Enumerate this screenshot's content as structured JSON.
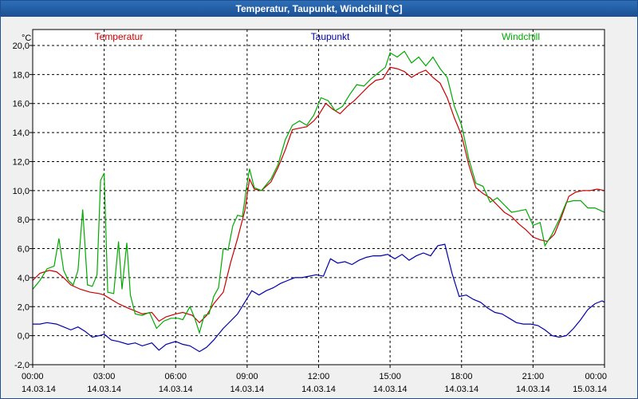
{
  "window": {
    "title": "Temperatur, Taupunkt, Windchill [°C]"
  },
  "chart_data": {
    "type": "line",
    "title": "Temperatur, Taupunkt, Windchill [°C]",
    "ylabel": "°C",
    "ylim": [
      -2,
      20
    ],
    "xlim": [
      0,
      24
    ],
    "grid": true,
    "legend": "top",
    "yticks": [
      {
        "v": 20,
        "label": "20,0"
      },
      {
        "v": 18,
        "label": "18,0"
      },
      {
        "v": 16,
        "label": "16,0"
      },
      {
        "v": 14,
        "label": "14,0"
      },
      {
        "v": 12,
        "label": "12,0"
      },
      {
        "v": 10,
        "label": "10,0"
      },
      {
        "v": 8,
        "label": "8,0"
      },
      {
        "v": 6,
        "label": "6,0"
      },
      {
        "v": 4,
        "label": "4,0"
      },
      {
        "v": 2,
        "label": "2,0"
      },
      {
        "v": 0,
        "label": "0,0"
      },
      {
        "v": -2,
        "label": "-2,0"
      }
    ],
    "xticks": [
      {
        "v": 0,
        "time": "00:00",
        "date": "14.03.14"
      },
      {
        "v": 3,
        "time": "03:00",
        "date": "14.03.14"
      },
      {
        "v": 6,
        "time": "06:00",
        "date": "14.03.14"
      },
      {
        "v": 9,
        "time": "09:00",
        "date": "14.03.14"
      },
      {
        "v": 12,
        "time": "12:00",
        "date": "14.03.14"
      },
      {
        "v": 15,
        "time": "15:00",
        "date": "14.03.14"
      },
      {
        "v": 18,
        "time": "18:00",
        "date": "14.03.14"
      },
      {
        "v": 21,
        "time": "21:00",
        "date": "14.03.14"
      },
      {
        "v": 24,
        "time": "00:00",
        "date": "15.03.14"
      }
    ],
    "series": [
      {
        "name": "Temperatur",
        "color": "#cc0000",
        "points": [
          [
            0,
            3.8
          ],
          [
            0.3,
            4.3
          ],
          [
            0.7,
            4.5
          ],
          [
            1.0,
            4.4
          ],
          [
            1.3,
            4.0
          ],
          [
            1.6,
            3.5
          ],
          [
            2.0,
            3.2
          ],
          [
            2.4,
            3.0
          ],
          [
            2.8,
            2.9
          ],
          [
            3.0,
            2.8
          ],
          [
            3.3,
            2.5
          ],
          [
            3.6,
            2.2
          ],
          [
            4.0,
            1.9
          ],
          [
            4.3,
            1.7
          ],
          [
            4.6,
            1.5
          ],
          [
            5.0,
            1.6
          ],
          [
            5.3,
            1.0
          ],
          [
            5.6,
            1.3
          ],
          [
            6.0,
            1.5
          ],
          [
            6.3,
            1.6
          ],
          [
            6.7,
            1.4
          ],
          [
            7.0,
            0.9
          ],
          [
            7.3,
            1.4
          ],
          [
            7.6,
            2.2
          ],
          [
            8.0,
            3.0
          ],
          [
            8.3,
            5.0
          ],
          [
            8.6,
            6.7
          ],
          [
            8.9,
            8.6
          ],
          [
            9.1,
            10.8
          ],
          [
            9.3,
            10.1
          ],
          [
            9.6,
            10.0
          ],
          [
            10.0,
            10.6
          ],
          [
            10.3,
            11.6
          ],
          [
            10.6,
            12.8
          ],
          [
            10.9,
            14.2
          ],
          [
            11.2,
            14.3
          ],
          [
            11.5,
            14.4
          ],
          [
            11.8,
            14.8
          ],
          [
            12.0,
            15.2
          ],
          [
            12.3,
            16.0
          ],
          [
            12.6,
            15.6
          ],
          [
            12.9,
            15.3
          ],
          [
            13.2,
            15.8
          ],
          [
            13.5,
            16.2
          ],
          [
            13.8,
            16.7
          ],
          [
            14.1,
            17.2
          ],
          [
            14.4,
            17.6
          ],
          [
            14.7,
            17.7
          ],
          [
            15.0,
            18.5
          ],
          [
            15.3,
            18.4
          ],
          [
            15.6,
            18.2
          ],
          [
            15.9,
            17.8
          ],
          [
            16.2,
            18.1
          ],
          [
            16.5,
            18.3
          ],
          [
            16.8,
            17.8
          ],
          [
            17.1,
            17.4
          ],
          [
            17.4,
            16.4
          ],
          [
            17.7,
            15.0
          ],
          [
            18.0,
            13.8
          ],
          [
            18.3,
            11.8
          ],
          [
            18.6,
            10.2
          ],
          [
            18.9,
            9.8
          ],
          [
            19.2,
            9.5
          ],
          [
            19.5,
            9.0
          ],
          [
            19.8,
            8.5
          ],
          [
            20.1,
            8.2
          ],
          [
            20.4,
            7.7
          ],
          [
            20.7,
            7.3
          ],
          [
            21.0,
            6.8
          ],
          [
            21.3,
            6.6
          ],
          [
            21.6,
            6.5
          ],
          [
            21.9,
            7.0
          ],
          [
            22.2,
            8.2
          ],
          [
            22.5,
            9.6
          ],
          [
            22.8,
            9.9
          ],
          [
            23.1,
            10.0
          ],
          [
            23.4,
            10.0
          ],
          [
            23.7,
            10.1
          ],
          [
            24.0,
            10.0
          ]
        ]
      },
      {
        "name": "Taupunkt",
        "color": "#0000aa",
        "points": [
          [
            0,
            0.8
          ],
          [
            0.3,
            0.8
          ],
          [
            0.6,
            0.9
          ],
          [
            1.0,
            0.8
          ],
          [
            1.3,
            0.6
          ],
          [
            1.6,
            0.4
          ],
          [
            1.9,
            0.6
          ],
          [
            2.2,
            0.3
          ],
          [
            2.5,
            -0.1
          ],
          [
            2.8,
            0.0
          ],
          [
            3.0,
            0.1
          ],
          [
            3.3,
            -0.3
          ],
          [
            3.6,
            -0.4
          ],
          [
            4.0,
            -0.6
          ],
          [
            4.3,
            -0.5
          ],
          [
            4.6,
            -0.7
          ],
          [
            5.0,
            -0.5
          ],
          [
            5.3,
            -1.0
          ],
          [
            5.6,
            -0.6
          ],
          [
            6.0,
            -0.4
          ],
          [
            6.3,
            -0.6
          ],
          [
            6.6,
            -0.7
          ],
          [
            7.0,
            -1.1
          ],
          [
            7.3,
            -0.8
          ],
          [
            7.6,
            -0.3
          ],
          [
            8.0,
            0.5
          ],
          [
            8.3,
            1.0
          ],
          [
            8.6,
            1.5
          ],
          [
            8.9,
            2.3
          ],
          [
            9.2,
            3.1
          ],
          [
            9.5,
            2.8
          ],
          [
            9.8,
            3.1
          ],
          [
            10.1,
            3.3
          ],
          [
            10.4,
            3.6
          ],
          [
            10.7,
            3.8
          ],
          [
            11.0,
            4.0
          ],
          [
            11.3,
            4.0
          ],
          [
            11.6,
            4.1
          ],
          [
            11.9,
            4.2
          ],
          [
            12.2,
            4.1
          ],
          [
            12.5,
            5.3
          ],
          [
            12.8,
            5.0
          ],
          [
            13.1,
            5.1
          ],
          [
            13.4,
            4.9
          ],
          [
            13.7,
            5.2
          ],
          [
            14.0,
            5.4
          ],
          [
            14.3,
            5.5
          ],
          [
            14.6,
            5.5
          ],
          [
            14.9,
            5.6
          ],
          [
            15.2,
            5.3
          ],
          [
            15.5,
            5.6
          ],
          [
            15.8,
            5.2
          ],
          [
            16.1,
            5.5
          ],
          [
            16.4,
            5.7
          ],
          [
            16.7,
            5.5
          ],
          [
            17.0,
            6.2
          ],
          [
            17.3,
            6.3
          ],
          [
            17.6,
            4.3
          ],
          [
            17.9,
            2.7
          ],
          [
            18.2,
            2.8
          ],
          [
            18.5,
            2.5
          ],
          [
            18.8,
            2.3
          ],
          [
            19.1,
            1.9
          ],
          [
            19.4,
            1.6
          ],
          [
            19.7,
            1.5
          ],
          [
            20.0,
            1.2
          ],
          [
            20.3,
            0.9
          ],
          [
            20.6,
            0.8
          ],
          [
            20.9,
            0.8
          ],
          [
            21.2,
            0.7
          ],
          [
            21.5,
            0.4
          ],
          [
            21.8,
            0.0
          ],
          [
            22.1,
            -0.1
          ],
          [
            22.4,
            0.0
          ],
          [
            22.7,
            0.5
          ],
          [
            23.0,
            1.1
          ],
          [
            23.3,
            1.8
          ],
          [
            23.6,
            2.2
          ],
          [
            23.9,
            2.4
          ],
          [
            24.0,
            2.3
          ]
        ]
      },
      {
        "name": "Windchill",
        "color": "#00aa00",
        "points": [
          [
            0,
            3.2
          ],
          [
            0.3,
            3.8
          ],
          [
            0.6,
            4.6
          ],
          [
            0.9,
            4.8
          ],
          [
            1.1,
            6.7
          ],
          [
            1.3,
            4.5
          ],
          [
            1.5,
            3.8
          ],
          [
            1.7,
            3.5
          ],
          [
            1.9,
            4.5
          ],
          [
            2.1,
            8.7
          ],
          [
            2.3,
            3.5
          ],
          [
            2.5,
            3.4
          ],
          [
            2.7,
            4.2
          ],
          [
            2.85,
            10.7
          ],
          [
            3.0,
            11.2
          ],
          [
            3.15,
            3.0
          ],
          [
            3.4,
            2.9
          ],
          [
            3.6,
            6.5
          ],
          [
            3.75,
            3.2
          ],
          [
            3.95,
            6.4
          ],
          [
            4.1,
            2.8
          ],
          [
            4.3,
            1.5
          ],
          [
            4.6,
            1.4
          ],
          [
            4.9,
            1.6
          ],
          [
            5.2,
            0.5
          ],
          [
            5.5,
            1.0
          ],
          [
            5.8,
            1.2
          ],
          [
            6.1,
            1.2
          ],
          [
            6.3,
            1.1
          ],
          [
            6.6,
            2.0
          ],
          [
            6.8,
            1.2
          ],
          [
            7.0,
            0.2
          ],
          [
            7.2,
            1.4
          ],
          [
            7.4,
            1.5
          ],
          [
            7.6,
            2.7
          ],
          [
            7.8,
            3.3
          ],
          [
            8.0,
            6.0
          ],
          [
            8.2,
            5.9
          ],
          [
            8.4,
            7.6
          ],
          [
            8.6,
            8.3
          ],
          [
            8.8,
            8.2
          ],
          [
            9.0,
            10.5
          ],
          [
            9.1,
            11.5
          ],
          [
            9.3,
            10.2
          ],
          [
            9.6,
            10.0
          ],
          [
            10.0,
            10.8
          ],
          [
            10.3,
            11.8
          ],
          [
            10.6,
            13.5
          ],
          [
            10.9,
            14.5
          ],
          [
            11.2,
            14.8
          ],
          [
            11.5,
            14.5
          ],
          [
            11.8,
            15.2
          ],
          [
            12.1,
            16.4
          ],
          [
            12.4,
            16.2
          ],
          [
            12.7,
            15.5
          ],
          [
            13.0,
            15.8
          ],
          [
            13.3,
            16.6
          ],
          [
            13.6,
            17.3
          ],
          [
            13.9,
            17.2
          ],
          [
            14.2,
            17.7
          ],
          [
            14.5,
            18.1
          ],
          [
            14.8,
            18.5
          ],
          [
            15.0,
            19.5
          ],
          [
            15.3,
            19.2
          ],
          [
            15.6,
            19.6
          ],
          [
            15.9,
            18.8
          ],
          [
            16.2,
            19.2
          ],
          [
            16.5,
            18.6
          ],
          [
            16.8,
            19.2
          ],
          [
            17.1,
            18.4
          ],
          [
            17.4,
            17.8
          ],
          [
            17.7,
            15.8
          ],
          [
            18.0,
            14.5
          ],
          [
            18.3,
            12.2
          ],
          [
            18.6,
            10.5
          ],
          [
            18.9,
            10.3
          ],
          [
            19.2,
            9.2
          ],
          [
            19.5,
            9.5
          ],
          [
            19.8,
            9.0
          ],
          [
            20.1,
            8.5
          ],
          [
            20.4,
            8.6
          ],
          [
            20.7,
            8.7
          ],
          [
            21.0,
            7.6
          ],
          [
            21.3,
            7.8
          ],
          [
            21.5,
            6.2
          ],
          [
            21.8,
            7.0
          ],
          [
            22.1,
            8.0
          ],
          [
            22.4,
            9.2
          ],
          [
            22.7,
            9.3
          ],
          [
            23.0,
            9.3
          ],
          [
            23.3,
            8.8
          ],
          [
            23.6,
            8.8
          ],
          [
            24.0,
            8.5
          ]
        ]
      }
    ]
  }
}
